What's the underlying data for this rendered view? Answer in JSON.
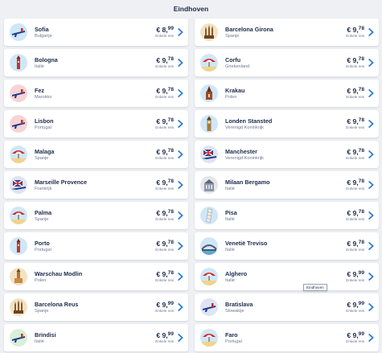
{
  "header": {
    "title": "Eindhoven"
  },
  "tooltip": {
    "text": "Eindhoven"
  },
  "colors": {
    "text": "#1c2a4a",
    "muted": "#6d7890",
    "chevron": "#2a7bd6",
    "background": "#eef0f3",
    "card": "#ffffff"
  },
  "destinations": [
    {
      "city": "Sofia",
      "country": "Bulgarije",
      "price_main": "€ 8,",
      "price_dec": "99",
      "note": "Enkele reis",
      "icon": "plane-icon",
      "bg": "#cfe7f7"
    },
    {
      "city": "Barcelona Girona",
      "country": "Spanje",
      "price_main": "€ 9,",
      "price_dec": "78",
      "note": "Enkele reis",
      "icon": "sagrada-familia-icon",
      "bg": "#f3e2c4"
    },
    {
      "city": "Bologna",
      "country": "Italië",
      "price_main": "€ 9,",
      "price_dec": "78",
      "note": "Enkele reis",
      "icon": "tower-icon",
      "bg": "#cfe7f7"
    },
    {
      "city": "Corfu",
      "country": "Griekenland",
      "price_main": "€ 9,",
      "price_dec": "78",
      "note": "Enkele reis",
      "icon": "beach-umbrella-icon",
      "bg": "#cfe7f7"
    },
    {
      "city": "Fez",
      "country": "Marokko",
      "price_main": "€ 9,",
      "price_dec": "78",
      "note": "Enkele reis",
      "icon": "plane-icon",
      "bg": "#f6d4d4"
    },
    {
      "city": "Krakau",
      "country": "Polen",
      "price_main": "€ 9,",
      "price_dec": "78",
      "note": "Enkele reis",
      "icon": "church-icon",
      "bg": "#cfe7f7"
    },
    {
      "city": "Lisbon",
      "country": "Portugal",
      "price_main": "€ 9,",
      "price_dec": "78",
      "note": "Enkele reis",
      "icon": "plane-icon",
      "bg": "#f6d4d4"
    },
    {
      "city": "Londen Stansted",
      "country": "Verenigd Koninkrijk",
      "price_main": "€ 9,",
      "price_dec": "78",
      "note": "Enkele reis",
      "icon": "big-ben-icon",
      "bg": "#cfe7f7"
    },
    {
      "city": "Malaga",
      "country": "Spanje",
      "price_main": "€ 9,",
      "price_dec": "78",
      "note": "Enkele reis",
      "icon": "beach-umbrella-icon",
      "bg": "#cfe7f7"
    },
    {
      "city": "Manchester",
      "country": "Verenigd Koninkrijk",
      "price_main": "€ 9,",
      "price_dec": "78",
      "note": "Enkele reis",
      "icon": "plane-flag-icon",
      "bg": "#dde4f2"
    },
    {
      "city": "Marseille Provence",
      "country": "Frankrijk",
      "price_main": "€ 9,",
      "price_dec": "78",
      "note": "Enkele reis",
      "icon": "plane-flag-icon",
      "bg": "#dde4f2"
    },
    {
      "city": "Milaan Bergamo",
      "country": "Italië",
      "price_main": "€ 9,",
      "price_dec": "78",
      "note": "Enkele reis",
      "icon": "cathedral-icon",
      "bg": "#e4e6ea"
    },
    {
      "city": "Palma",
      "country": "Spanje",
      "price_main": "€ 9,",
      "price_dec": "78",
      "note": "Enkele reis",
      "icon": "beach-umbrella-icon",
      "bg": "#cfe7f7"
    },
    {
      "city": "Pisa",
      "country": "Italië",
      "price_main": "€ 9,",
      "price_dec": "78",
      "note": "Enkele reis",
      "icon": "leaning-tower-icon",
      "bg": "#cfe7f7"
    },
    {
      "city": "Porto",
      "country": "Portugal",
      "price_main": "€ 9,",
      "price_dec": "78",
      "note": "Enkele reis",
      "icon": "tower-icon",
      "bg": "#cfe7f7"
    },
    {
      "city": "Venetië Treviso",
      "country": "Italië",
      "price_main": "€ 9,",
      "price_dec": "78",
      "note": "Enkele reis",
      "icon": "bridge-icon",
      "bg": "#cfe7f7"
    },
    {
      "city": "Warschau Modlin",
      "country": "Polen",
      "price_main": "€ 9,",
      "price_dec": "78",
      "note": "Enkele reis",
      "icon": "palace-tower-icon",
      "bg": "#f3e2c4"
    },
    {
      "city": "Alghero",
      "country": "Italië",
      "price_main": "€ 9,",
      "price_dec": "99",
      "note": "Enkele reis",
      "icon": "beach-umbrella-icon",
      "bg": "#cfe7f7"
    },
    {
      "city": "Barcelona Reus",
      "country": "Spanje",
      "price_main": "€ 9,",
      "price_dec": "99",
      "note": "Enkele reis",
      "icon": "sagrada-familia-icon",
      "bg": "#f3e2c4"
    },
    {
      "city": "Bratislava",
      "country": "Slowakije",
      "price_main": "€ 9,",
      "price_dec": "99",
      "note": "Enkele reis",
      "icon": "plane-icon",
      "bg": "#dde4f2"
    },
    {
      "city": "Brindisi",
      "country": "Italië",
      "price_main": "€ 9,",
      "price_dec": "99",
      "note": "Enkele reis",
      "icon": "plane-icon",
      "bg": "#d8efd8"
    },
    {
      "city": "Faro",
      "country": "Portugal",
      "price_main": "€ 9,",
      "price_dec": "99",
      "note": "Enkele reis",
      "icon": "beach-umbrella-icon",
      "bg": "#cfe7f7"
    }
  ]
}
